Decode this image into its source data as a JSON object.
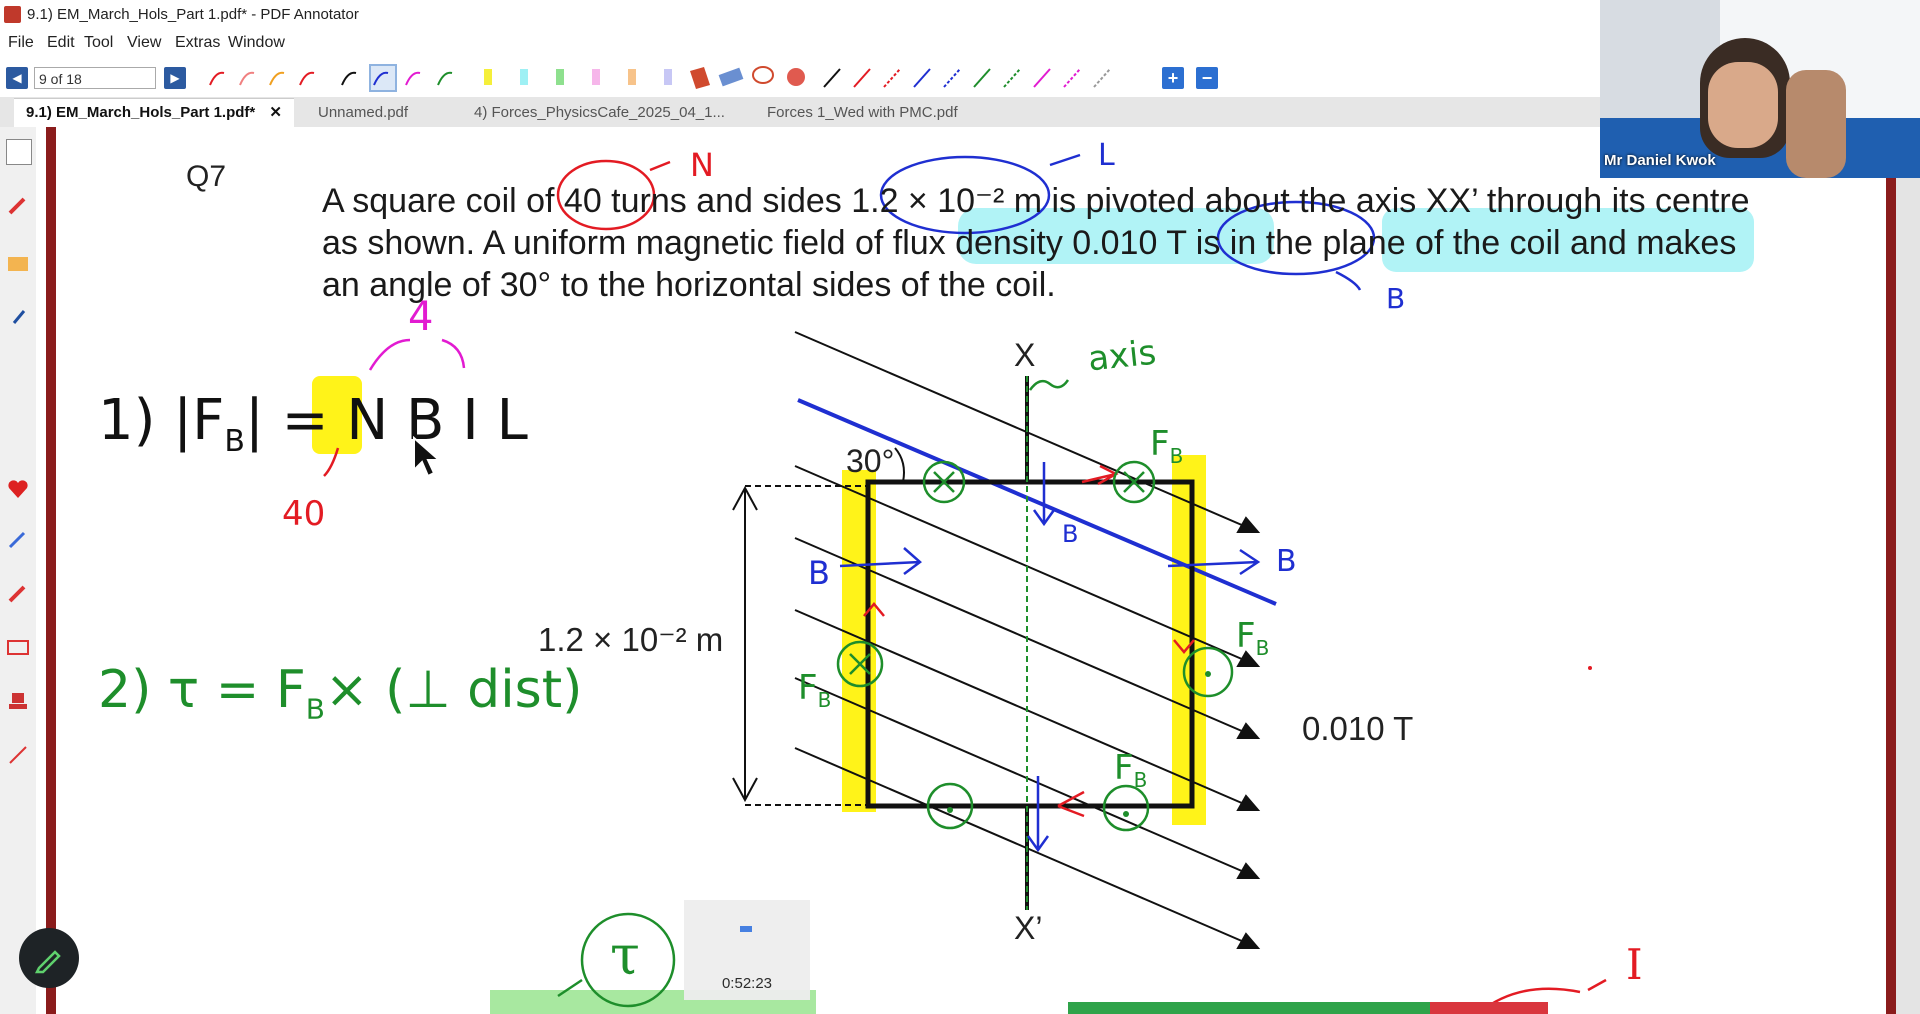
{
  "window": {
    "title": "9.1) EM_March_Hols_Part 1.pdf* - PDF Annotator"
  },
  "menu": {
    "items": [
      "File",
      "Edit",
      "Tool",
      "View",
      "Extras",
      "Window"
    ]
  },
  "toolbar": {
    "page_field": "9 of 18",
    "prev_icon": "previous-page-icon",
    "next_icon": "next-page-icon",
    "zoom_in": "+",
    "zoom_out": "−"
  },
  "tabs": [
    {
      "label": "9.1) EM_March_Hols_Part 1.pdf*",
      "active": true
    },
    {
      "label": "Unnamed.pdf",
      "active": false
    },
    {
      "label": "4) Forces_PhysicsCafe_2025_04_1...",
      "active": false
    },
    {
      "label": "Forces 1_Wed with PMC.pdf",
      "active": false
    }
  ],
  "webcam": {
    "name": "Mr Daniel Kwok"
  },
  "question": {
    "number": "Q7",
    "text": "A square coil of 40 turns and sides 1.2 × 10⁻² m is pivoted about the axis XX’ through its centre as shown. A uniform magnetic field of flux density 0.010 T is in the plane of the coil and makes an angle of 30° to the horizontal sides of the coil."
  },
  "diagram": {
    "label_x": "X",
    "label_x_prime": "X’",
    "label_angle": "30°",
    "label_length": "1.2 × 10⁻² m",
    "label_field": "0.010 T"
  },
  "annotations": {
    "n_label": "N",
    "l_label": "L",
    "b_label": "B",
    "axis_label": "axis",
    "eq1": "1) |F",
    "eq1_sub": "B",
    "eq1_rest": "| = N B I L",
    "forty": "40",
    "four": "4",
    "eq2": "2) τ = F",
    "eq2_sub": "B",
    "eq2_rest": "× (⊥ dist)",
    "tau": "τ",
    "i_label": "I",
    "fb": "F",
    "fb_sub": "B"
  },
  "player": {
    "time": "0:52:23"
  },
  "colors": {
    "accent_blue": "#2c5aa0",
    "highlight_yellow": "#fff200",
    "highlight_cyan": "#9ef0f4",
    "pen_red": "#e31b23",
    "pen_blue": "#1f2fd1",
    "pen_green": "#1e8e2b",
    "pen_magenta": "#e21bd1"
  }
}
